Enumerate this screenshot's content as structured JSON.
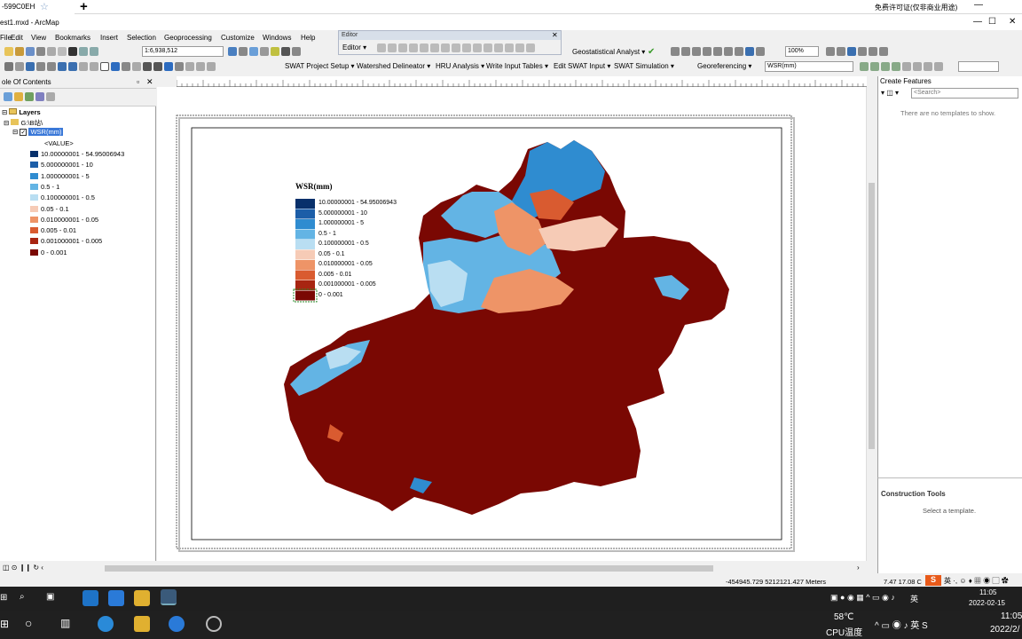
{
  "browser_tab": {
    "label": "-599C0EH"
  },
  "license_note": "免费许可证(仅非商业用途)",
  "window": {
    "title": "est1.mxd - ArcMap"
  },
  "menu": [
    "File",
    "Edit",
    "View",
    "Bookmarks",
    "Insert",
    "Selection",
    "Geoprocessing",
    "Customize",
    "Windows",
    "Help"
  ],
  "toolbar": {
    "scale_value": "1:6,938,512",
    "geostatistical_label": "Geostatistical Analyst ▾",
    "zoom_value": "100%",
    "swat_items": [
      "SWAT Project Setup ▾",
      "Watershed Delineator ▾",
      "HRU Analysis ▾",
      "Write Input Tables ▾",
      "Edit SWAT Input ▾",
      "SWAT Simulation ▾"
    ],
    "georef_label": "Georeferencing ▾",
    "georef_layer": "WSR(mm)"
  },
  "editor": {
    "title": "Editor",
    "menu_label": "Editor ▾"
  },
  "toc": {
    "title": "ole Of Contents",
    "layers_label": "Layers",
    "folder_label": "G:\\B站\\",
    "layer_label": "WSR(mm)",
    "value_label": "<VALUE>",
    "classes": [
      {
        "label": "10.00000001 - 54.95006943",
        "color": "#08306b"
      },
      {
        "label": "5.000000001 - 10",
        "color": "#1c5ea8"
      },
      {
        "label": "1.000000001 - 5",
        "color": "#2f8cd0"
      },
      {
        "label": "0.5 - 1",
        "color": "#63b4e4"
      },
      {
        "label": "0.100000001 - 0.5",
        "color": "#b9def2"
      },
      {
        "label": "0.05 - 0.1",
        "color": "#f6cbb6"
      },
      {
        "label": "0.010000001 - 0.05",
        "color": "#ee9467"
      },
      {
        "label": "0.005 - 0.01",
        "color": "#d95b30"
      },
      {
        "label": "0.001000001 - 0.005",
        "color": "#a82512"
      },
      {
        "label": "0 - 0.001",
        "color": "#7a0803"
      }
    ]
  },
  "map_legend": {
    "title": "WSR(mm)"
  },
  "create_features": {
    "title": "Create Features",
    "search_placeholder": "<Search>",
    "empty_text": "There are no templates to show."
  },
  "construction_tools": {
    "title": "Construction Tools",
    "empty_text": "Select a template."
  },
  "status": {
    "coords": "-454945.729  5212121.427 Meters",
    "page_coords": "7.47  17.08 C"
  },
  "tray": {
    "time1": "11:05",
    "date1": "2022-02-15",
    "time2": "11:05",
    "date2": "2022/2/",
    "temp": "58℃",
    "cpu_label": "CPU温度",
    "ime": "英"
  }
}
